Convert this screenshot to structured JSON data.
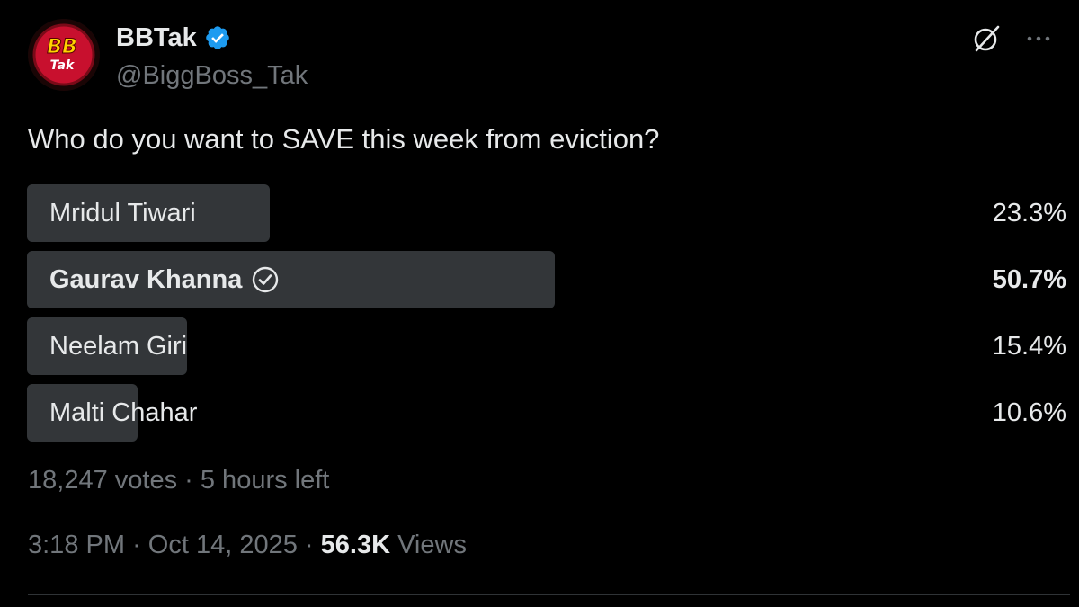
{
  "account": {
    "display_name": "BBTak",
    "handle": "@BiggBoss_Tak",
    "avatar_text": "BB",
    "avatar_subtext": "Tak",
    "verified_icon": "verified-badge-icon",
    "verified_color": "#1d9bf0"
  },
  "actions": {
    "grok_icon": "grok-icon",
    "more_icon": "more-options-icon"
  },
  "tweet": {
    "text": "Who do you want to SAVE this week from eviction?"
  },
  "poll": {
    "options": [
      {
        "label": "Mridul Tiwari",
        "percent_text": "23.3%",
        "percent": 23.3,
        "winner": false
      },
      {
        "label": "Gaurav Khanna",
        "percent_text": "50.7%",
        "percent": 50.7,
        "winner": true
      },
      {
        "label": "Neelam Giri",
        "percent_text": "15.4%",
        "percent": 15.4,
        "winner": false
      },
      {
        "label": "Malti Chahar",
        "percent_text": "10.6%",
        "percent": 10.6,
        "winner": false
      }
    ],
    "votes": "18,247 votes",
    "separator": "·",
    "time_left": "5 hours left"
  },
  "meta": {
    "time": "3:18 PM",
    "separator": "·",
    "date": "Oct 14, 2025",
    "views_count": "56.3K",
    "views_label": "Views"
  },
  "colors": {
    "background": "#000000",
    "bar": "#333639",
    "secondary_text": "#71767b",
    "primary_text": "#e7e9ea",
    "avatar_red": "#c8102e",
    "avatar_yellow": "#ffd200"
  }
}
